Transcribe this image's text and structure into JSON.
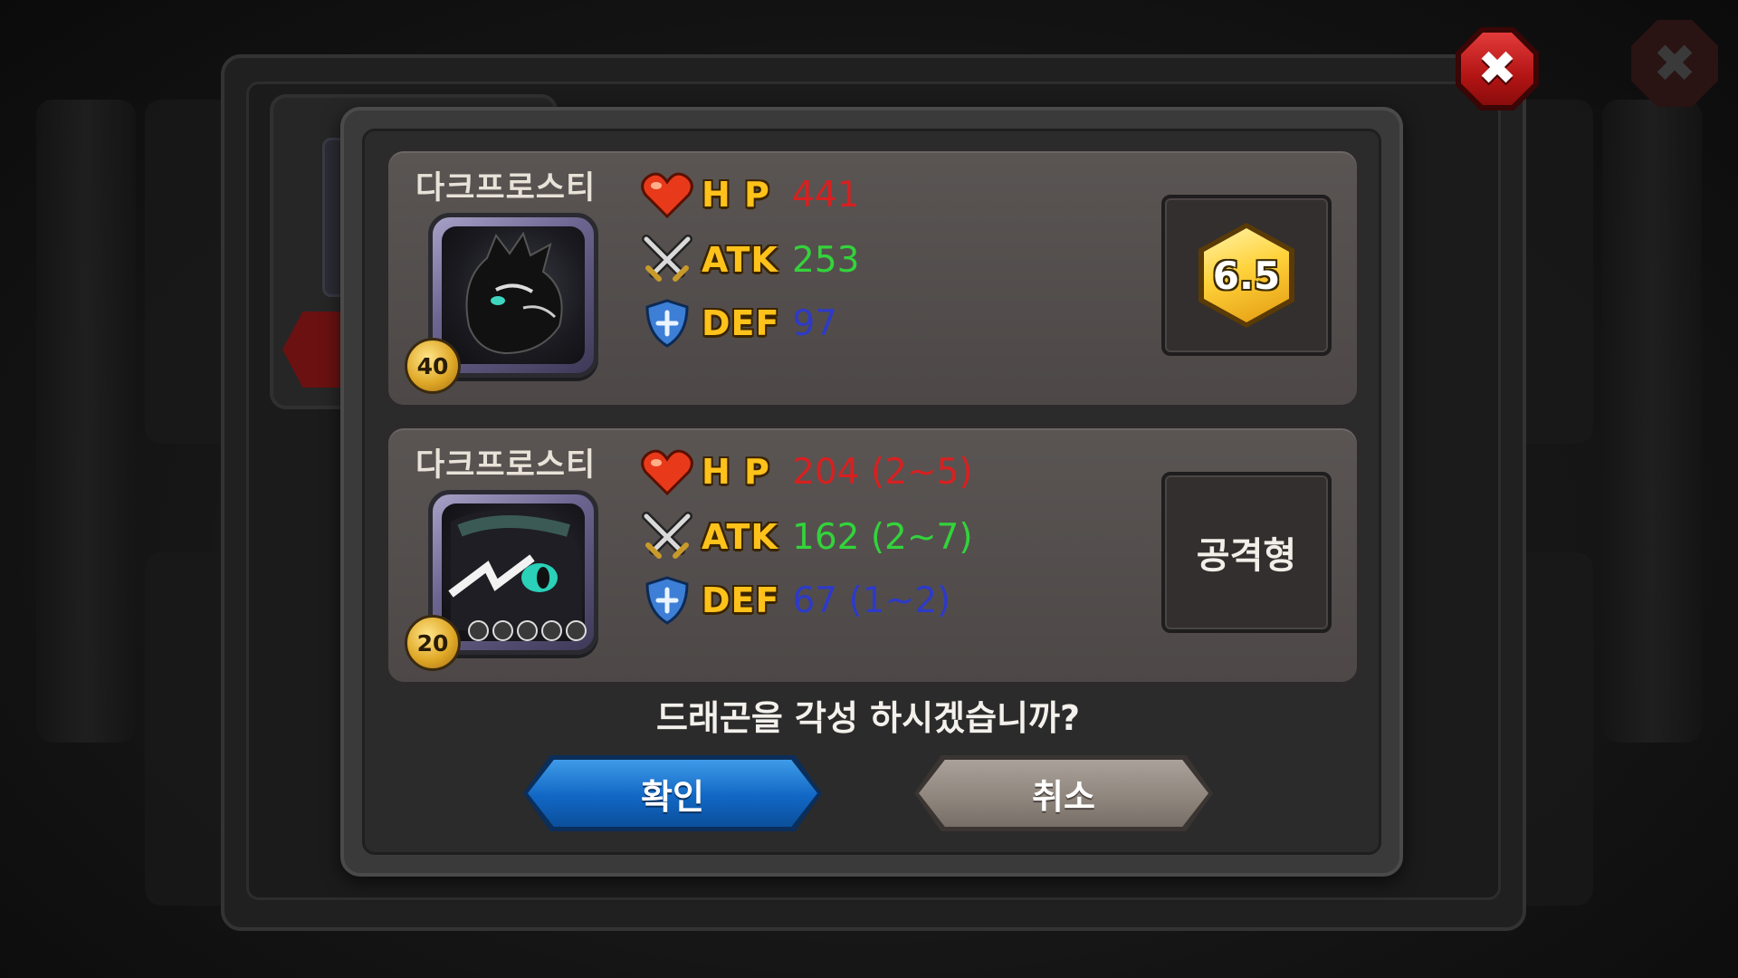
{
  "dialog": {
    "question": "드래곤을 각성 하시겠습니까?",
    "confirm_label": "확인",
    "cancel_label": "취소",
    "close_symbol": "✖"
  },
  "cards": [
    {
      "name": "다크프로스티",
      "level": "40",
      "stats": {
        "hp_label": "H P",
        "hp_value": "441",
        "atk_label": "ATK",
        "atk_value": "253",
        "def_label": "DEF",
        "def_value": "97"
      },
      "grade": "6.5"
    },
    {
      "name": "다크프로스티",
      "level": "20",
      "star_slots": 5,
      "stats": {
        "hp_label": "H P",
        "hp_value": "204 (2~5)",
        "atk_label": "ATK",
        "atk_value": "162 (2~7)",
        "def_label": "DEF",
        "def_value": "67 (1~2)"
      },
      "type": "공격형"
    }
  ],
  "colors": {
    "hp": "#d82020",
    "atk": "#33d33b",
    "def": "#2d3ac8",
    "confirm": "#1167c4",
    "cancel": "#8d847c",
    "close": "#b31414"
  },
  "icons": [
    "heart-icon",
    "crossed-swords-icon",
    "shield-icon",
    "close-icon",
    "grade-hexagon-icon"
  ]
}
